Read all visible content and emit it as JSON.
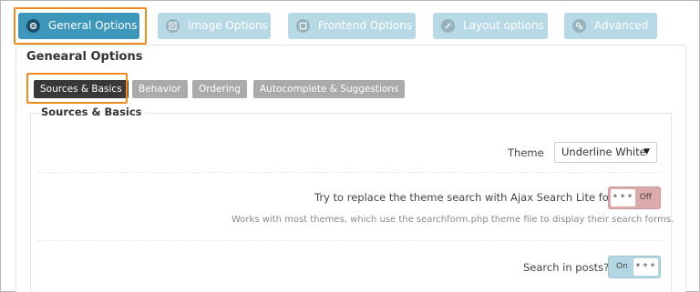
{
  "top_tabs": [
    {
      "label": "General Options",
      "icon": "gear-icon",
      "active": true
    },
    {
      "label": "Image Options",
      "icon": "image-icon",
      "active": false
    },
    {
      "label": "Frontend Options",
      "icon": "frontend-icon",
      "active": false
    },
    {
      "label": "Layout options",
      "icon": "pencil-icon",
      "active": false
    },
    {
      "label": "Advanced",
      "icon": "cogs-icon",
      "active": false
    }
  ],
  "panel_title": "Genearal Options",
  "sub_tabs": [
    {
      "label": "Sources & Basics",
      "active": true
    },
    {
      "label": "Behavior",
      "active": false
    },
    {
      "label": "Ordering",
      "active": false
    },
    {
      "label": "Autocomplete & Suggestions",
      "active": false
    }
  ],
  "section_title": "Sources & Basics",
  "rows": {
    "theme": {
      "label": "Theme",
      "value": "Underline White",
      "caret": "▼"
    },
    "replace_search": {
      "label": "Try to replace the theme search with Ajax Search Lite form?",
      "note": "Works with most themes, which use the searchform.php theme file to display their search forms.",
      "state_label": "Off",
      "knob": "•••"
    },
    "search_posts": {
      "label": "Search in posts?",
      "state_label": "On",
      "knob": "•••"
    }
  },
  "colors": {
    "active_tab": "#3d97bb",
    "inactive_tab": "#b7d9e6",
    "highlight": "#ef8a1f",
    "active_subtab": "#383838",
    "inactive_subtab": "#aaaaaa",
    "toggle_off": "#dcaaab",
    "toggle_on": "#b3d6e3"
  }
}
